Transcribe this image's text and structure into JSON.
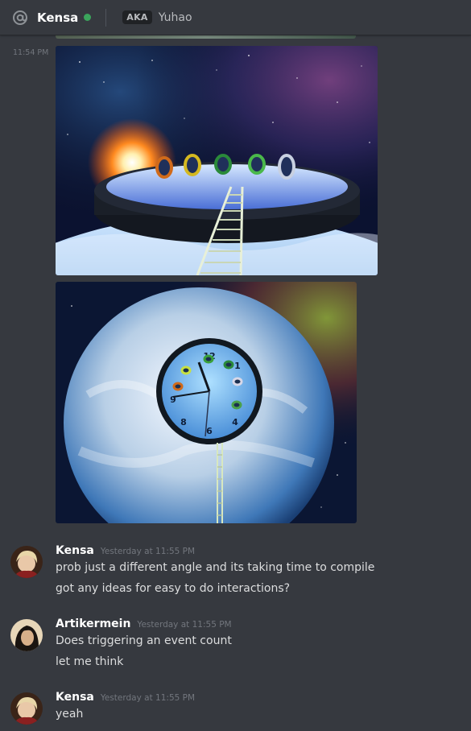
{
  "header": {
    "name": "Kensa",
    "status_color": "#3ba55c",
    "aka_label": "AKA",
    "aka_name": "Yuhao"
  },
  "media_group": {
    "time": "11:54 PM",
    "images": [
      {
        "description_icon": "image-icon",
        "subject": "space-platform-portals"
      },
      {
        "description_icon": "image-icon",
        "subject": "earth-clock-portals"
      }
    ]
  },
  "messages": [
    {
      "author": "Kensa",
      "timestamp": "Yesterday at 11:55 PM",
      "lines": [
        "prob just a different angle and its taking time to compile",
        "got any ideas for easy to do interactions?"
      ]
    },
    {
      "author": "Artikermein",
      "timestamp": "Yesterday at 11:55 PM",
      "lines": [
        "Does triggering an event count",
        "let me think"
      ]
    },
    {
      "author": "Kensa",
      "timestamp": "Yesterday at 11:55 PM",
      "lines": [
        "yeah"
      ]
    }
  ],
  "colors": {
    "background": "#36393f",
    "username": "#ffffff",
    "text": "#dcddde",
    "muted": "#72767d",
    "online": "#3ba55c"
  }
}
